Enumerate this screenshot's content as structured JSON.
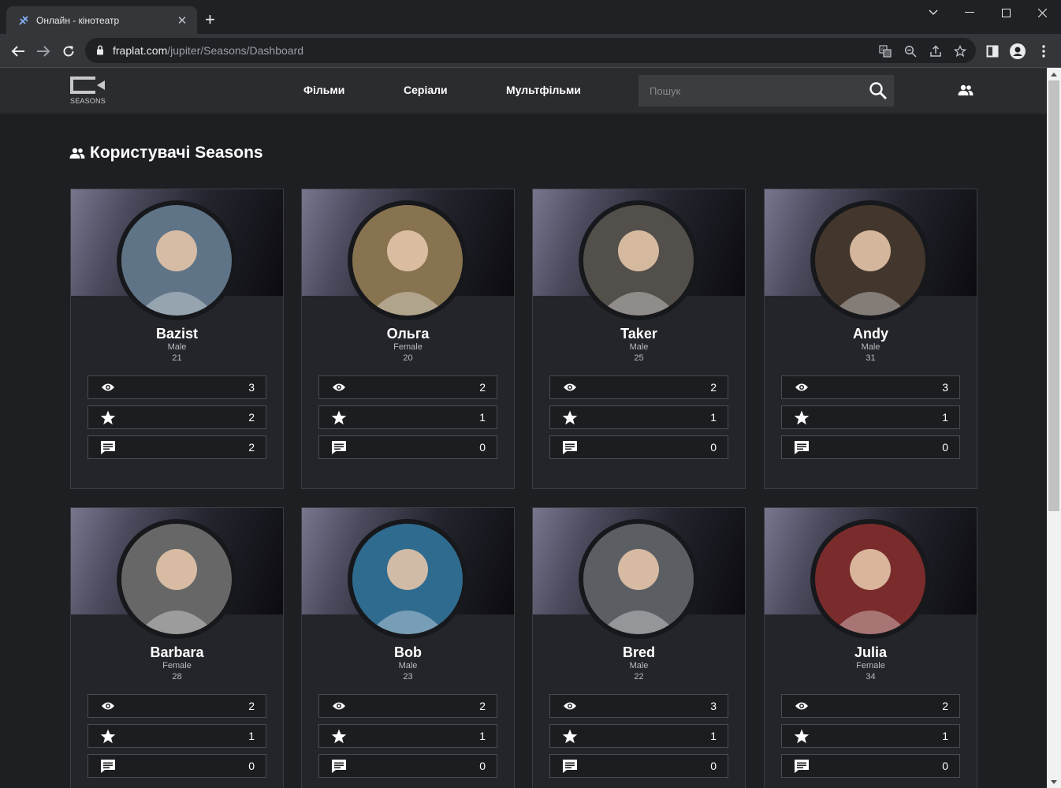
{
  "browser": {
    "tab_title": "Онлайн - кінотеатр",
    "url_host": "fraplat.com",
    "url_path": "/jupiter/Seasons/Dashboard"
  },
  "site": {
    "logo_text": "SEASONS",
    "nav": [
      "Фільми",
      "Серіали",
      "Мультфільми"
    ],
    "search_placeholder": "Пошук",
    "page_title": "Користувачі Seasons"
  },
  "users": [
    {
      "name": "Bazist",
      "gender": "Male",
      "age": "21",
      "views": "3",
      "ratings": "2",
      "comments": "2",
      "avatar_color": "#7f9bb3"
    },
    {
      "name": "Ольга",
      "gender": "Female",
      "age": "20",
      "views": "2",
      "ratings": "1",
      "comments": "0",
      "avatar_color": "#b59a6a"
    },
    {
      "name": "Taker",
      "gender": "Male",
      "age": "25",
      "views": "2",
      "ratings": "1",
      "comments": "0",
      "avatar_color": "#6f6a63"
    },
    {
      "name": "Andy",
      "gender": "Male",
      "age": "31",
      "views": "3",
      "ratings": "1",
      "comments": "0",
      "avatar_color": "#5a4a3c"
    },
    {
      "name": "Barbara",
      "gender": "Female",
      "age": "28",
      "views": "2",
      "ratings": "1",
      "comments": "0",
      "avatar_color": "#8a8a8a"
    },
    {
      "name": "Bob",
      "gender": "Male",
      "age": "23",
      "views": "2",
      "ratings": "1",
      "comments": "0",
      "avatar_color": "#3f8fbf"
    },
    {
      "name": "Bred",
      "gender": "Male",
      "age": "22",
      "views": "3",
      "ratings": "1",
      "comments": "0",
      "avatar_color": "#7a7f86"
    },
    {
      "name": "Julia",
      "gender": "Female",
      "age": "34",
      "views": "2",
      "ratings": "1",
      "comments": "0",
      "avatar_color": "#a33a3a"
    }
  ],
  "colors": {
    "page_bg": "#1e1f22",
    "header_bg": "#2b2c2f",
    "card_bg": "#24252a"
  }
}
